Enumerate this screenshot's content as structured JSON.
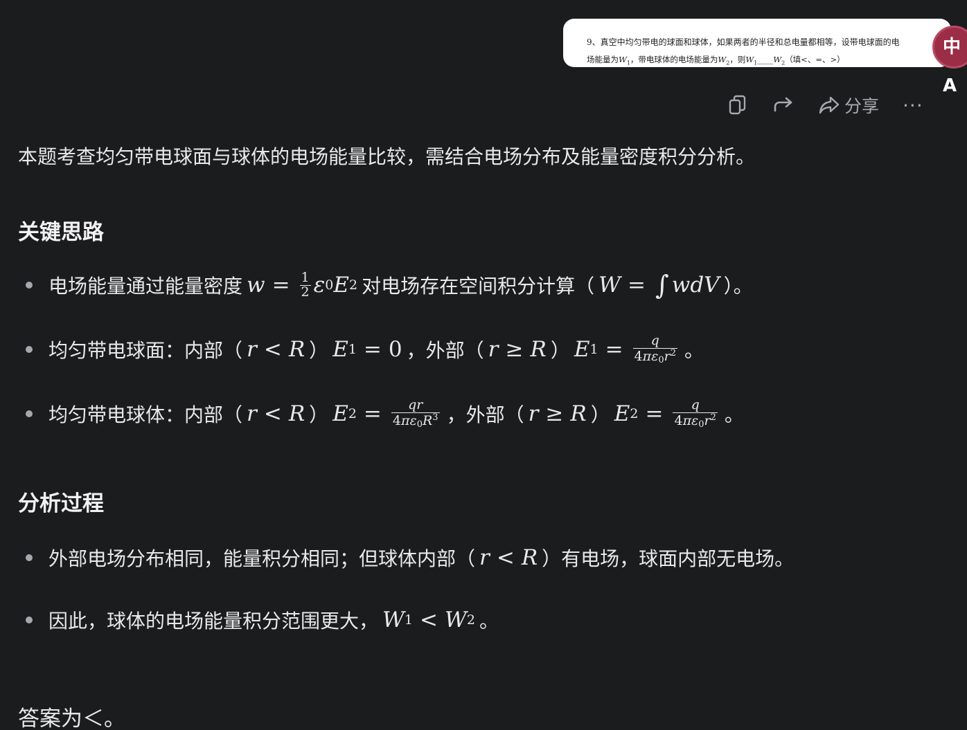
{
  "question_image": {
    "line1": "9、真空中均匀带电的球面和球体，如果两者的半径和总电量都相等，设带电球面的电",
    "line2_prefix": "场能量为",
    "line2_mid": "，带电球体的电场能量为",
    "line2_then": "，则",
    "line2_blank": "____",
    "line2_suffix": "（填<、=、>）",
    "w": "W",
    "sub1": "1",
    "sub2": "2"
  },
  "translate_badge": {
    "icon": "translate-icon",
    "glyph": "中A"
  },
  "toolbar": {
    "copy_icon": "copy-icon",
    "redo_icon": "redo-icon",
    "share_icon": "share-icon",
    "share_label": "分享",
    "more_label": "···"
  },
  "answer": {
    "intro": "本题考查均匀带电球面与球体的电场能量比较，需结合电场分布及能量密度积分分析。",
    "section_key": "关键思路",
    "key_points": [
      {
        "t1": "电场能量通过能量密度",
        "t2": "对电场存在空间积分计算（",
        "t3": "）。"
      },
      {
        "t1": "均匀带电球面：内部（",
        "t2": "）",
        "t3": "，外部（",
        "t4": "）",
        "t5": "。"
      },
      {
        "t1": "均匀带电球体：内部（",
        "t2": "）",
        "t3": "，外部（",
        "t4": "）",
        "t5": "。"
      }
    ],
    "section_analysis": "分析过程",
    "analysis_points": [
      {
        "t1": "外部电场分布相同，能量积分相同；但球体内部（",
        "t2": "）有电场，球面内部无电场。"
      },
      {
        "t1": "因此，球体的电场能量积分范围更大，",
        "t2": "。"
      }
    ],
    "final": "答案为＜。"
  },
  "colors": {
    "background": "#1b1c1e",
    "text": "#e9e9ea",
    "toolbar_icon": "#a8a9ad",
    "badge": "#9c2d46"
  }
}
